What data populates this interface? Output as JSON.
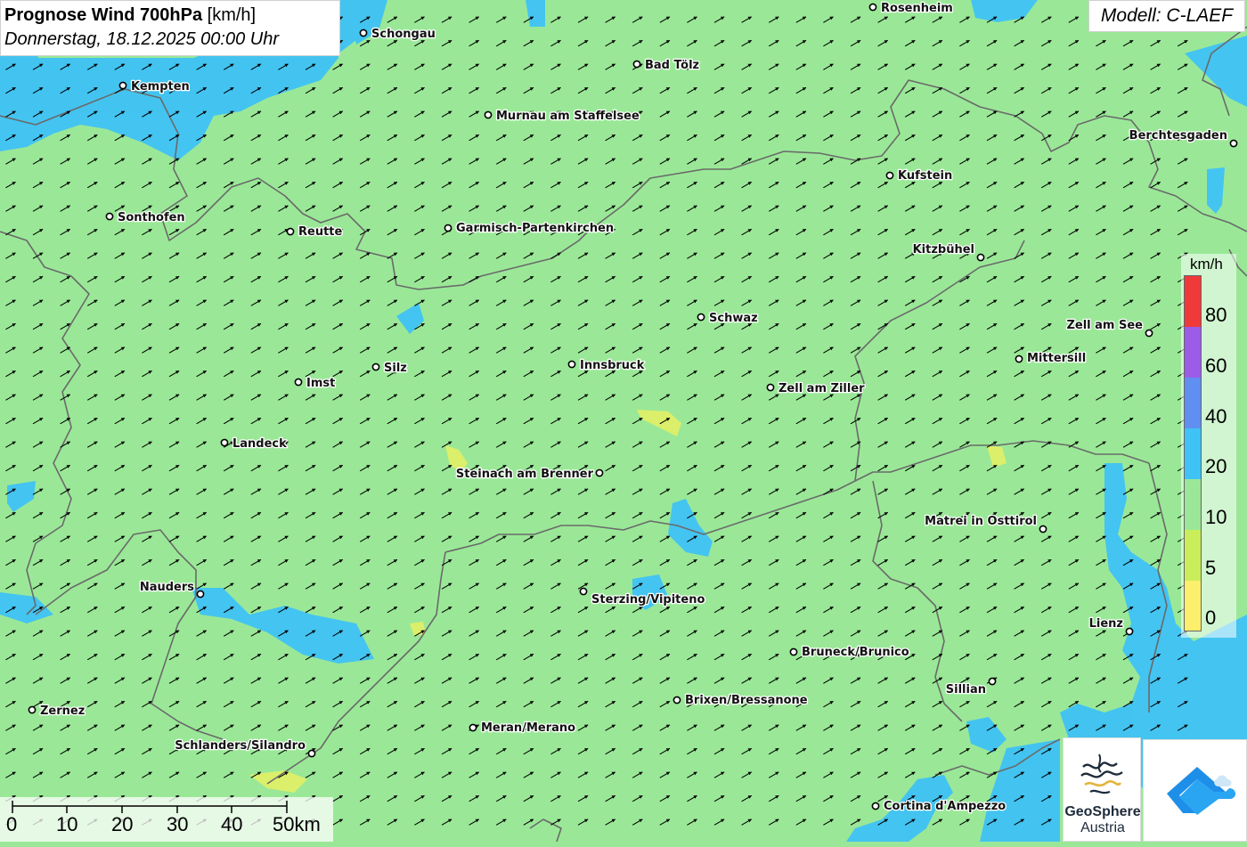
{
  "title": {
    "bold": "Prognose Wind 700hPa",
    "unit": " [km/h]",
    "date": "Donnerstag, 18.12.2025 00:00 Uhr"
  },
  "model": "Modell: C-LAEF",
  "legend": {
    "unit": "km/h",
    "labels": [
      "80",
      "60",
      "40",
      "20",
      "10",
      "5",
      "0"
    ],
    "colors": [
      "#f03a3a",
      "#9b5ce8",
      "#5f8ff0",
      "#3fc2f5",
      "#9ae897",
      "#c9ee5a",
      "#fbef6c"
    ]
  },
  "scale": {
    "labels": [
      "0",
      "10",
      "20",
      "30",
      "40",
      "50km"
    ]
  },
  "logo": {
    "line1": "GeoSphere",
    "line2": "Austria"
  },
  "wind": {
    "direction_deg": 60,
    "field_color": "#9ae897"
  },
  "colors": {
    "wind_10_20": "#9ae897",
    "wind_20_40": "#3fc2f5",
    "wind_5_10": "#c9ee5a",
    "wind_0_5": "#fbef6c",
    "border": "#6a6a6a"
  },
  "cities": [
    {
      "name": "Rosenheim",
      "dot": [
        980,
        8
      ],
      "lbl": [
        989,
        13
      ],
      "anchor": "start"
    },
    {
      "name": "Schongau",
      "dot": [
        408,
        37
      ],
      "lbl": [
        417,
        42
      ],
      "anchor": "start"
    },
    {
      "name": "Bad Tölz",
      "dot": [
        715,
        72
      ],
      "lbl": [
        724,
        77
      ],
      "anchor": "start"
    },
    {
      "name": "Kempten",
      "dot": [
        138,
        96
      ],
      "lbl": [
        147,
        101
      ],
      "anchor": "start"
    },
    {
      "name": "Murnau am Staffelsee",
      "dot": [
        548,
        129
      ],
      "lbl": [
        557,
        134
      ],
      "anchor": "start"
    },
    {
      "name": "Berchtesgaden",
      "dot": [
        1385,
        161
      ],
      "lbl": [
        1378,
        156
      ],
      "anchor": "end"
    },
    {
      "name": "Kufstein",
      "dot": [
        999,
        197
      ],
      "lbl": [
        1008,
        201
      ],
      "anchor": "start"
    },
    {
      "name": "Sonthofen",
      "dot": [
        123,
        243
      ],
      "lbl": [
        132,
        248
      ],
      "anchor": "start"
    },
    {
      "name": "Garmisch-Partenkirchen",
      "dot": [
        503,
        256
      ],
      "lbl": [
        512,
        260
      ],
      "anchor": "start"
    },
    {
      "name": "Reutte",
      "dot": [
        326,
        260
      ],
      "lbl": [
        335,
        264
      ],
      "anchor": "start"
    },
    {
      "name": "Kitzbühel",
      "dot": [
        1101,
        289
      ],
      "lbl": [
        1094,
        284
      ],
      "anchor": "end"
    },
    {
      "name": "Schwaz",
      "dot": [
        787,
        356
      ],
      "lbl": [
        796,
        361
      ],
      "anchor": "start"
    },
    {
      "name": "Zell am See",
      "dot": [
        1290,
        374
      ],
      "lbl": [
        1283,
        369
      ],
      "anchor": "end"
    },
    {
      "name": "Mittersill",
      "dot": [
        1144,
        403
      ],
      "lbl": [
        1153,
        406
      ],
      "anchor": "start"
    },
    {
      "name": "Innsbruck",
      "dot": [
        642,
        409
      ],
      "lbl": [
        651,
        414
      ],
      "anchor": "start"
    },
    {
      "name": "Silz",
      "dot": [
        422,
        412
      ],
      "lbl": [
        431,
        417
      ],
      "anchor": "start"
    },
    {
      "name": "Imst",
      "dot": [
        335,
        429
      ],
      "lbl": [
        344,
        434
      ],
      "anchor": "start"
    },
    {
      "name": "Zell am Ziller",
      "dot": [
        865,
        435
      ],
      "lbl": [
        874,
        440
      ],
      "anchor": "start"
    },
    {
      "name": "Landeck",
      "dot": [
        252,
        497
      ],
      "lbl": [
        261,
        502
      ],
      "anchor": "start"
    },
    {
      "name": "Steinach am Brenner",
      "dot": [
        673,
        531
      ],
      "lbl": [
        666,
        536
      ],
      "anchor": "end"
    },
    {
      "name": "Matrei in Osttirol",
      "dot": [
        1171,
        594
      ],
      "lbl": [
        1164,
        589
      ],
      "anchor": "end"
    },
    {
      "name": "Nauders",
      "dot": [
        225,
        667
      ],
      "lbl": [
        218,
        663
      ],
      "anchor": "end"
    },
    {
      "name": "Sterzing/Vipiteno",
      "dot": [
        655,
        664
      ],
      "lbl": [
        664,
        677
      ],
      "anchor": "start"
    },
    {
      "name": "Lienz",
      "dot": [
        1268,
        709
      ],
      "lbl": [
        1261,
        704
      ],
      "anchor": "end"
    },
    {
      "name": "Bruneck/Brunico",
      "dot": [
        891,
        732
      ],
      "lbl": [
        900,
        736
      ],
      "anchor": "start"
    },
    {
      "name": "Sillian",
      "dot": [
        1114,
        765
      ],
      "lbl": [
        1107,
        778
      ],
      "anchor": "end"
    },
    {
      "name": "Brixen/Bressanone",
      "dot": [
        760,
        786
      ],
      "lbl": [
        769,
        790
      ],
      "anchor": "start"
    },
    {
      "name": "Zernez",
      "dot": [
        36,
        797
      ],
      "lbl": [
        45,
        802
      ],
      "anchor": "start"
    },
    {
      "name": "Meran/Merano",
      "dot": [
        531,
        817
      ],
      "lbl": [
        540,
        821
      ],
      "anchor": "start"
    },
    {
      "name": "Schlanders/Silandro",
      "dot": [
        350,
        846
      ],
      "lbl": [
        343,
        841
      ],
      "anchor": "end"
    },
    {
      "name": "Cortina d'Ampezzo",
      "dot": [
        983,
        905
      ],
      "lbl": [
        992,
        909
      ],
      "anchor": "start"
    }
  ]
}
